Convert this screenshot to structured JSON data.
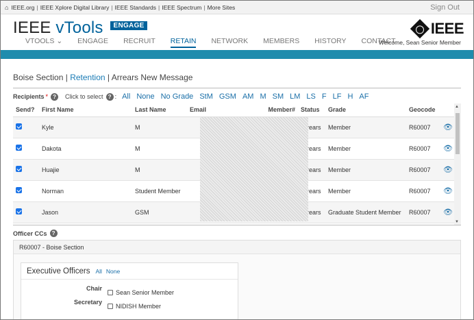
{
  "topbar": {
    "links": [
      "IEEE.org",
      "IEEE Xplore Digital Library",
      "IEEE Standards",
      "IEEE Spectrum",
      "More Sites"
    ],
    "separator": "|",
    "sign_out": "Sign Out"
  },
  "header": {
    "brand_ieee": "IEEE",
    "brand_vtools": "vTools",
    "badge": "ENGAGE",
    "logo_text": "IEEE",
    "nav": [
      {
        "label": "VTOOLS ⌄",
        "active": false
      },
      {
        "label": "ENGAGE",
        "active": false
      },
      {
        "label": "RECRUIT",
        "active": false
      },
      {
        "label": "RETAIN",
        "active": true
      },
      {
        "label": "NETWORK",
        "active": false
      },
      {
        "label": "MEMBERS",
        "active": false
      },
      {
        "label": "HISTORY",
        "active": false
      },
      {
        "label": "CONTACT",
        "active": false
      }
    ],
    "welcome": "Welcome, Sean Senior Member"
  },
  "breadcrumb": {
    "section": "Boise Section",
    "sep": "|",
    "link": "Retention",
    "current": "Arrears New Message"
  },
  "recipients": {
    "label": "Recipients",
    "required": "*",
    "help": "?",
    "click_label": "Click to select",
    "filters": [
      "All",
      "None",
      "No Grade",
      "StM",
      "GSM",
      "AM",
      "M",
      "SM",
      "LM",
      "LS",
      "F",
      "LF",
      "H",
      "AF"
    ]
  },
  "table": {
    "columns": [
      "Send?",
      "First Name",
      "Last Name",
      "Email",
      "Member#",
      "Status",
      "Grade",
      "Geocode",
      ""
    ],
    "rows": [
      {
        "first": "Kyle",
        "last": "M",
        "status": "Arrears",
        "grade": "Member",
        "geocode": "R60007"
      },
      {
        "first": "Dakota",
        "last": "M",
        "status": "Arrears",
        "grade": "Member",
        "geocode": "R60007"
      },
      {
        "first": "Huajie",
        "last": "M",
        "status": "Arrears",
        "grade": "Member",
        "geocode": "R60007"
      },
      {
        "first": "Norman",
        "last": "Student Member",
        "status": "Arrears",
        "grade": "Member",
        "geocode": "R60007"
      },
      {
        "first": "Jason",
        "last": "GSM",
        "status": "Arrears",
        "grade": "Graduate Student Member",
        "geocode": "R60007"
      }
    ]
  },
  "officers": {
    "title": "Officer CCs",
    "section_label": "R60007 - Boise Section",
    "exec_title": "Executive Officers",
    "all": "All",
    "none": "None",
    "roles": [
      {
        "role": "Chair",
        "name": "Sean Senior Member"
      },
      {
        "role": "Secretary",
        "name": "NIDISH Member"
      }
    ]
  }
}
